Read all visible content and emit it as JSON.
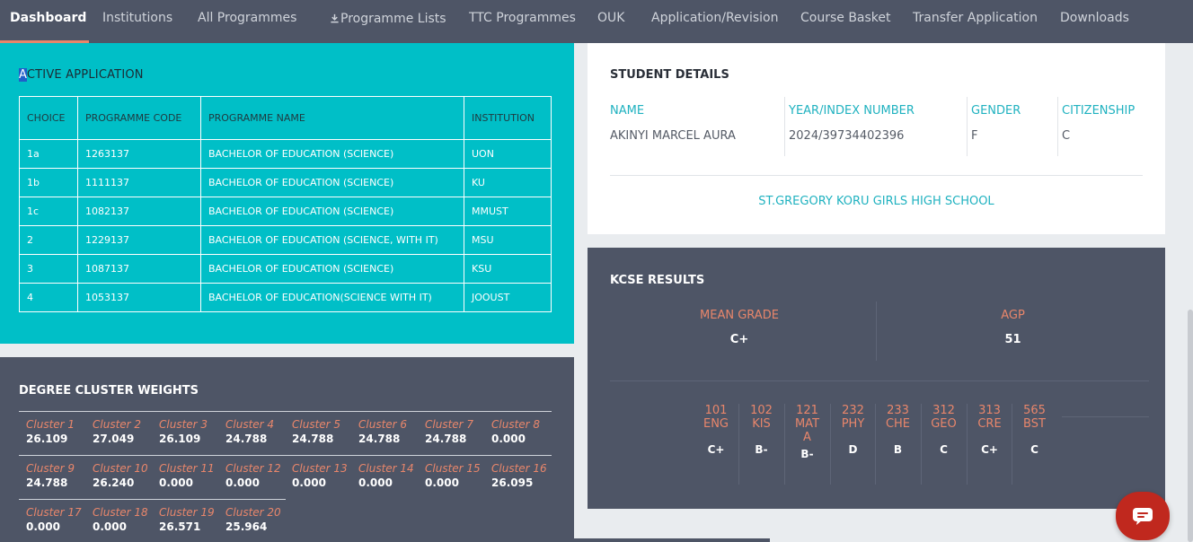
{
  "nav": {
    "items": [
      {
        "label": "Dashboard"
      },
      {
        "label": "Institutions"
      },
      {
        "label": "All Programmes"
      },
      {
        "label": "Programme Lists",
        "icon": "download-icon"
      },
      {
        "label": "TTC Programmes"
      },
      {
        "label": "OUK"
      },
      {
        "label": "Application/Revision"
      },
      {
        "label": "Course Basket"
      },
      {
        "label": "Transfer Application"
      },
      {
        "label": "Downloads"
      }
    ],
    "active_index": 0
  },
  "active_application": {
    "title_first": "A",
    "title_rest": "CTIVE APPLICATION",
    "headers": [
      "CHOICE",
      "PROGRAMME CODE",
      "PROGRAMME NAME",
      "INSTITUTION"
    ],
    "rows": [
      [
        "1a",
        "1263137",
        "BACHELOR OF EDUCATION (SCIENCE)",
        "UON"
      ],
      [
        "1b",
        "1111137",
        "BACHELOR OF EDUCATION (SCIENCE)",
        "KU"
      ],
      [
        "1c",
        "1082137",
        "BACHELOR OF EDUCATION (SCIENCE)",
        "MMUST"
      ],
      [
        "2",
        "1229137",
        "BACHELOR OF EDUCATION (SCIENCE, WITH IT)",
        "MSU"
      ],
      [
        "3",
        "1087137",
        "BACHELOR OF EDUCATION (SCIENCE)",
        "KSU"
      ],
      [
        "4",
        "1053137",
        "BACHELOR OF EDUCATION(SCIENCE WITH IT)",
        "JOOUST"
      ]
    ]
  },
  "cluster_weights": {
    "title": "DEGREE CLUSTER WEIGHTS",
    "clusters": [
      {
        "name": "Cluster 1",
        "value": "26.109"
      },
      {
        "name": "Cluster 2",
        "value": "27.049"
      },
      {
        "name": "Cluster 3",
        "value": "26.109"
      },
      {
        "name": "Cluster 4",
        "value": "24.788"
      },
      {
        "name": "Cluster 5",
        "value": "24.788"
      },
      {
        "name": "Cluster 6",
        "value": "24.788"
      },
      {
        "name": "Cluster 7",
        "value": "24.788"
      },
      {
        "name": "Cluster 8",
        "value": "0.000"
      },
      {
        "name": "Cluster 9",
        "value": "24.788"
      },
      {
        "name": "Cluster 10",
        "value": "26.240"
      },
      {
        "name": "Cluster 11",
        "value": "0.000"
      },
      {
        "name": "Cluster 12",
        "value": "0.000"
      },
      {
        "name": "Cluster 13",
        "value": "0.000"
      },
      {
        "name": "Cluster 14",
        "value": "0.000"
      },
      {
        "name": "Cluster 15",
        "value": "0.000"
      },
      {
        "name": "Cluster 16",
        "value": "26.095"
      },
      {
        "name": "Cluster 17",
        "value": "0.000"
      },
      {
        "name": "Cluster 18",
        "value": "0.000"
      },
      {
        "name": "Cluster 19",
        "value": "26.571"
      },
      {
        "name": "Cluster 20",
        "value": "25.964"
      }
    ]
  },
  "student": {
    "title": "STUDENT DETAILS",
    "labels": {
      "name": "NAME",
      "index": "YEAR/INDEX NUMBER",
      "gender": "GENDER",
      "citizenship": "CITIZENSHIP"
    },
    "values": {
      "name": "AKINYI MARCEL AURA",
      "index": "2024/39734402396",
      "gender": "F",
      "citizenship": "C"
    },
    "school": "ST.GREGORY KORU GIRLS HIGH SCHOOL"
  },
  "kcse": {
    "title": "KCSE RESULTS",
    "mean_grade_label": "MEAN GRADE",
    "mean_grade": "C+",
    "agp_label": "AGP",
    "agp": "51",
    "subjects": [
      {
        "code": "101",
        "name": "ENG",
        "grade": "C+"
      },
      {
        "code": "102",
        "name": "KIS",
        "grade": "B-"
      },
      {
        "code": "121",
        "name": "MATA",
        "grade": "B-"
      },
      {
        "code": "232",
        "name": "PHY",
        "grade": "D"
      },
      {
        "code": "233",
        "name": "CHE",
        "grade": "B"
      },
      {
        "code": "312",
        "name": "GEO",
        "grade": "C"
      },
      {
        "code": "313",
        "name": "CRE",
        "grade": "C+"
      },
      {
        "code": "565",
        "name": "BST",
        "grade": "C"
      }
    ]
  },
  "colors": {
    "nav_bg": "#4e5566",
    "teal_panel": "#00bfc7",
    "accent_orange": "#e8866b",
    "label_teal": "#20b2c0",
    "chat_red": "#c0281e"
  },
  "chat": {
    "icon": "chat-bubble-icon"
  }
}
